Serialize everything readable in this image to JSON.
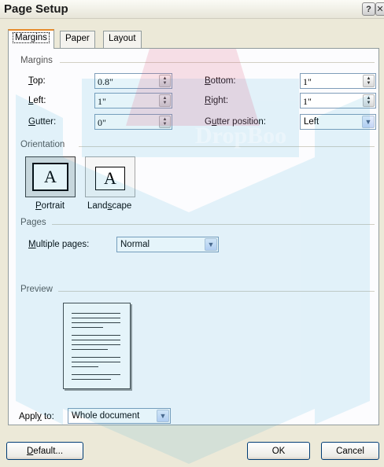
{
  "dialog": {
    "title": "Page Setup"
  },
  "tabs": [
    {
      "label": "Margins",
      "active": true
    },
    {
      "label": "Paper",
      "active": false
    },
    {
      "label": "Layout",
      "active": false
    }
  ],
  "margins": {
    "group_label": "Margins",
    "top": {
      "label": "Top:",
      "value": "0.8\""
    },
    "bottom": {
      "label": "Bottom:",
      "value": "1\""
    },
    "left": {
      "label": "Left:",
      "value": "1\""
    },
    "right": {
      "label": "Right:",
      "value": "1\""
    },
    "gutter": {
      "label": "Gutter:",
      "value": "0\""
    },
    "gutter_position": {
      "label": "Gutter position:",
      "value": "Left"
    }
  },
  "orientation": {
    "group_label": "Orientation",
    "portrait_label": "Portrait",
    "landscape_label": "Landscape",
    "selected": "Portrait",
    "icon_letter": "A"
  },
  "pages": {
    "group_label": "Pages",
    "multiple_pages_label": "Multiple pages:",
    "multiple_pages_value": "Normal"
  },
  "preview": {
    "group_label": "Preview",
    "apply_to_label": "Apply to:",
    "apply_to_value": "Whole document"
  },
  "buttons": {
    "default": "Default...",
    "ok": "OK",
    "cancel": "Cancel"
  },
  "watermark": {
    "text": "DropBoo"
  },
  "colors": {
    "focus_tab_accent": "#e68b2c",
    "dialog_bg": "#ece9d8",
    "watermark": "#2aa7d6"
  }
}
